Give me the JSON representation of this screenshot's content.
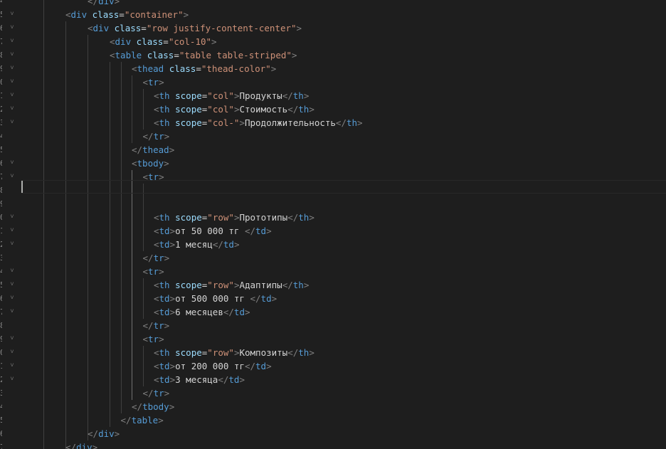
{
  "editor": {
    "colors": {
      "background": "#1e1e1e",
      "punctuation": "#808080",
      "tag": "#569cd6",
      "attribute": "#9cdcfe",
      "string": "#ce9178",
      "text": "#d4d4d4"
    },
    "line_numbers": [
      "4",
      "5",
      "6",
      "7",
      "8",
      "9",
      "0",
      "1",
      "2",
      "3",
      "4",
      "5",
      "6",
      "7",
      "8",
      "9",
      "0",
      "1",
      "2",
      "3",
      "4",
      "5",
      "6",
      "7",
      "8",
      "9",
      "0",
      "1",
      "2",
      "3",
      "4",
      "5",
      "6",
      "7"
    ],
    "lines": [
      {
        "indent": 3,
        "tokens": [
          [
            "p",
            "</"
          ],
          [
            "t",
            "div"
          ],
          [
            "p",
            ">"
          ]
        ]
      },
      {
        "indent": 2,
        "tokens": [
          [
            "p",
            "<"
          ],
          [
            "t",
            "div"
          ],
          [
            "x",
            " "
          ],
          [
            "a",
            "class"
          ],
          [
            "x",
            "="
          ],
          [
            "s",
            "\"container\""
          ],
          [
            "p",
            ">"
          ]
        ]
      },
      {
        "indent": 3,
        "tokens": [
          [
            "p",
            "<"
          ],
          [
            "t",
            "div"
          ],
          [
            "x",
            " "
          ],
          [
            "a",
            "class"
          ],
          [
            "x",
            "="
          ],
          [
            "s",
            "\"row justify-content-center\""
          ],
          [
            "p",
            ">"
          ]
        ]
      },
      {
        "indent": 4,
        "tokens": [
          [
            "p",
            "<"
          ],
          [
            "t",
            "div"
          ],
          [
            "x",
            " "
          ],
          [
            "a",
            "class"
          ],
          [
            "x",
            "="
          ],
          [
            "s",
            "\"col-10\""
          ],
          [
            "p",
            ">"
          ]
        ]
      },
      {
        "indent": 4,
        "tokens": [
          [
            "p",
            "<"
          ],
          [
            "t",
            "table"
          ],
          [
            "x",
            " "
          ],
          [
            "a",
            "class"
          ],
          [
            "x",
            "="
          ],
          [
            "s",
            "\"table table-striped\""
          ],
          [
            "p",
            ">"
          ]
        ]
      },
      {
        "indent": 5,
        "tokens": [
          [
            "p",
            "<"
          ],
          [
            "t",
            "thead"
          ],
          [
            "x",
            " "
          ],
          [
            "a",
            "class"
          ],
          [
            "x",
            "="
          ],
          [
            "s",
            "\"thead-color\""
          ],
          [
            "p",
            ">"
          ]
        ]
      },
      {
        "indent": 5.5,
        "tokens": [
          [
            "p",
            "<"
          ],
          [
            "t",
            "tr"
          ],
          [
            "p",
            ">"
          ]
        ]
      },
      {
        "indent": 6,
        "tokens": [
          [
            "p",
            "<"
          ],
          [
            "t",
            "th"
          ],
          [
            "x",
            " "
          ],
          [
            "a",
            "scope"
          ],
          [
            "x",
            "="
          ],
          [
            "s",
            "\"col\""
          ],
          [
            "p",
            ">"
          ],
          [
            "x",
            "Продукты"
          ],
          [
            "p",
            "</"
          ],
          [
            "t",
            "th"
          ],
          [
            "p",
            ">"
          ]
        ]
      },
      {
        "indent": 6,
        "tokens": [
          [
            "p",
            "<"
          ],
          [
            "t",
            "th"
          ],
          [
            "x",
            " "
          ],
          [
            "a",
            "scope"
          ],
          [
            "x",
            "="
          ],
          [
            "s",
            "\"col\""
          ],
          [
            "p",
            ">"
          ],
          [
            "x",
            "Стоимость"
          ],
          [
            "p",
            "</"
          ],
          [
            "t",
            "th"
          ],
          [
            "p",
            ">"
          ]
        ]
      },
      {
        "indent": 6,
        "tokens": [
          [
            "p",
            "<"
          ],
          [
            "t",
            "th"
          ],
          [
            "x",
            " "
          ],
          [
            "a",
            "scope"
          ],
          [
            "x",
            "="
          ],
          [
            "s",
            "\"col-\""
          ],
          [
            "p",
            ">"
          ],
          [
            "x",
            "Продолжительность"
          ],
          [
            "p",
            "</"
          ],
          [
            "t",
            "th"
          ],
          [
            "p",
            ">"
          ]
        ]
      },
      {
        "indent": 5.5,
        "tokens": [
          [
            "p",
            "</"
          ],
          [
            "t",
            "tr"
          ],
          [
            "p",
            ">"
          ]
        ]
      },
      {
        "indent": 5,
        "tokens": [
          [
            "p",
            "</"
          ],
          [
            "t",
            "thead"
          ],
          [
            "p",
            ">"
          ]
        ]
      },
      {
        "indent": 5,
        "tokens": [
          [
            "p",
            "<"
          ],
          [
            "t",
            "tbody"
          ],
          [
            "p",
            ">"
          ]
        ]
      },
      {
        "indent": 5.5,
        "tokens": [
          [
            "p",
            "<"
          ],
          [
            "t",
            "tr"
          ],
          [
            "p",
            ">"
          ]
        ]
      },
      {
        "indent": 0,
        "tokens": []
      },
      {
        "indent": 0,
        "tokens": []
      },
      {
        "indent": 6,
        "tokens": [
          [
            "p",
            "<"
          ],
          [
            "t",
            "th"
          ],
          [
            "x",
            " "
          ],
          [
            "a",
            "scope"
          ],
          [
            "x",
            "="
          ],
          [
            "s",
            "\"row\""
          ],
          [
            "p",
            ">"
          ],
          [
            "x",
            "Прототипы"
          ],
          [
            "p",
            "</"
          ],
          [
            "t",
            "th"
          ],
          [
            "p",
            ">"
          ]
        ]
      },
      {
        "indent": 6,
        "tokens": [
          [
            "p",
            "<"
          ],
          [
            "t",
            "td"
          ],
          [
            "p",
            ">"
          ],
          [
            "x",
            "от 50 000 тг "
          ],
          [
            "p",
            "</"
          ],
          [
            "t",
            "td"
          ],
          [
            "p",
            ">"
          ]
        ]
      },
      {
        "indent": 6,
        "tokens": [
          [
            "p",
            "<"
          ],
          [
            "t",
            "td"
          ],
          [
            "p",
            ">"
          ],
          [
            "x",
            "1 месяц"
          ],
          [
            "p",
            "</"
          ],
          [
            "t",
            "td"
          ],
          [
            "p",
            ">"
          ]
        ]
      },
      {
        "indent": 5.5,
        "tokens": [
          [
            "p",
            "</"
          ],
          [
            "t",
            "tr"
          ],
          [
            "p",
            ">"
          ]
        ]
      },
      {
        "indent": 5.5,
        "tokens": [
          [
            "p",
            "<"
          ],
          [
            "t",
            "tr"
          ],
          [
            "p",
            ">"
          ]
        ]
      },
      {
        "indent": 6,
        "tokens": [
          [
            "p",
            "<"
          ],
          [
            "t",
            "th"
          ],
          [
            "x",
            " "
          ],
          [
            "a",
            "scope"
          ],
          [
            "x",
            "="
          ],
          [
            "s",
            "\"row\""
          ],
          [
            "p",
            ">"
          ],
          [
            "x",
            "Адаптипы"
          ],
          [
            "p",
            "</"
          ],
          [
            "t",
            "th"
          ],
          [
            "p",
            ">"
          ]
        ]
      },
      {
        "indent": 6,
        "tokens": [
          [
            "p",
            "<"
          ],
          [
            "t",
            "td"
          ],
          [
            "p",
            ">"
          ],
          [
            "x",
            "от 500 000 тг "
          ],
          [
            "p",
            "</"
          ],
          [
            "t",
            "td"
          ],
          [
            "p",
            ">"
          ]
        ]
      },
      {
        "indent": 6,
        "tokens": [
          [
            "p",
            "<"
          ],
          [
            "t",
            "td"
          ],
          [
            "p",
            ">"
          ],
          [
            "x",
            "6 месяцев"
          ],
          [
            "p",
            "</"
          ],
          [
            "t",
            "td"
          ],
          [
            "p",
            ">"
          ]
        ]
      },
      {
        "indent": 5.5,
        "tokens": [
          [
            "p",
            "</"
          ],
          [
            "t",
            "tr"
          ],
          [
            "p",
            ">"
          ]
        ]
      },
      {
        "indent": 5.5,
        "tokens": [
          [
            "p",
            "<"
          ],
          [
            "t",
            "tr"
          ],
          [
            "p",
            ">"
          ]
        ]
      },
      {
        "indent": 6,
        "tokens": [
          [
            "p",
            "<"
          ],
          [
            "t",
            "th"
          ],
          [
            "x",
            " "
          ],
          [
            "a",
            "scope"
          ],
          [
            "x",
            "="
          ],
          [
            "s",
            "\"row\""
          ],
          [
            "p",
            ">"
          ],
          [
            "x",
            "Композиты"
          ],
          [
            "p",
            "</"
          ],
          [
            "t",
            "th"
          ],
          [
            "p",
            ">"
          ]
        ]
      },
      {
        "indent": 6,
        "tokens": [
          [
            "p",
            "<"
          ],
          [
            "t",
            "td"
          ],
          [
            "p",
            ">"
          ],
          [
            "x",
            "от 200 000 тг"
          ],
          [
            "p",
            "</"
          ],
          [
            "t",
            "td"
          ],
          [
            "p",
            ">"
          ]
        ]
      },
      {
        "indent": 6,
        "tokens": [
          [
            "p",
            "<"
          ],
          [
            "t",
            "td"
          ],
          [
            "p",
            ">"
          ],
          [
            "x",
            "3 месяца"
          ],
          [
            "p",
            "</"
          ],
          [
            "t",
            "td"
          ],
          [
            "p",
            ">"
          ]
        ]
      },
      {
        "indent": 5.5,
        "tokens": [
          [
            "p",
            "</"
          ],
          [
            "t",
            "tr"
          ],
          [
            "p",
            ">"
          ]
        ]
      },
      {
        "indent": 5,
        "tokens": [
          [
            "p",
            "</"
          ],
          [
            "t",
            "tbody"
          ],
          [
            "p",
            ">"
          ]
        ]
      },
      {
        "indent": 4.5,
        "tokens": [
          [
            "p",
            "</"
          ],
          [
            "t",
            "table"
          ],
          [
            "p",
            ">"
          ]
        ]
      },
      {
        "indent": 3,
        "tokens": [
          [
            "p",
            "</"
          ],
          [
            "t",
            "div"
          ],
          [
            "p",
            ">"
          ]
        ]
      },
      {
        "indent": 2,
        "tokens": [
          [
            "p",
            "</"
          ],
          [
            "t",
            "div"
          ],
          [
            "p",
            ">"
          ]
        ]
      },
      {
        "indent": 1,
        "tokens": [
          [
            "p",
            "</"
          ],
          [
            "t",
            "div"
          ],
          [
            "p",
            ">"
          ]
        ]
      }
    ]
  }
}
